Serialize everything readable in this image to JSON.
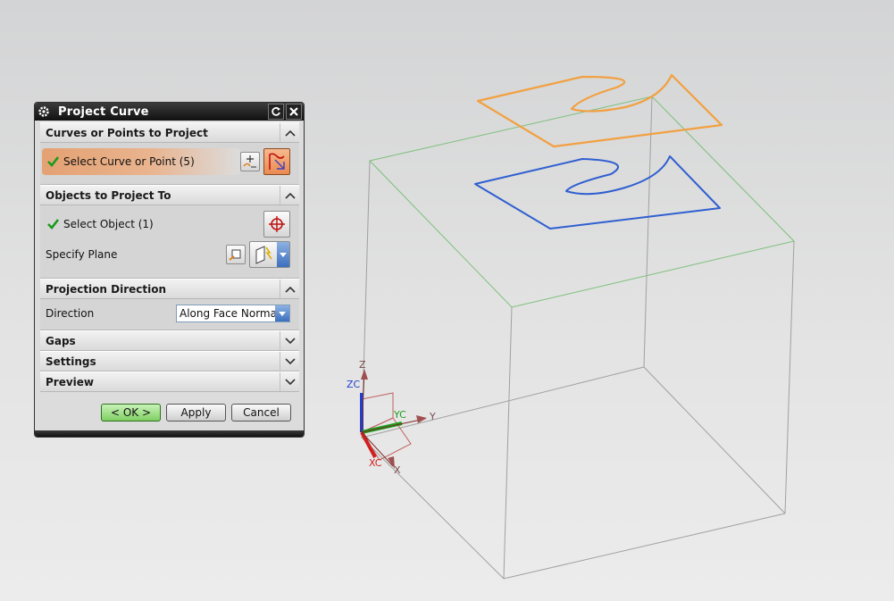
{
  "dialog": {
    "title": "Project Curve",
    "sections": {
      "curves": {
        "header": "Curves or Points to Project",
        "select_label": "Select Curve or Point (5)"
      },
      "objects": {
        "header": "Objects to Project To",
        "select_label": "Select Object (1)",
        "plane_label": "Specify Plane"
      },
      "projection": {
        "header": "Projection Direction",
        "direction_label": "Direction",
        "direction_value": "Along Face Normal"
      },
      "gaps": {
        "header": "Gaps"
      },
      "settings": {
        "header": "Settings"
      },
      "preview": {
        "header": "Preview"
      }
    },
    "buttons": {
      "ok": "< OK >",
      "apply": "Apply",
      "cancel": "Cancel"
    }
  },
  "triad": {
    "zc": "ZC",
    "yc": "YC",
    "xc": "XC",
    "z": "Z",
    "y": "Y",
    "x": "X"
  },
  "colors": {
    "curve_selected": "#f2a040",
    "curve_projected": "#2f5fd0",
    "box_top_edges": "#7cc07a",
    "box_edges": "#9a9a9a",
    "highlight_row": "#e4a172",
    "ok_button": "#7fcf63"
  },
  "icons": [
    "gear-icon",
    "reset-icon",
    "close-icon",
    "chevron-up-icon",
    "chevron-down-icon",
    "checkmark-icon",
    "curve-rule-icon",
    "select-curve-icon",
    "crosshair-icon",
    "plane-dialog-icon",
    "plane-icon",
    "dropdown-arrow-icon"
  ]
}
